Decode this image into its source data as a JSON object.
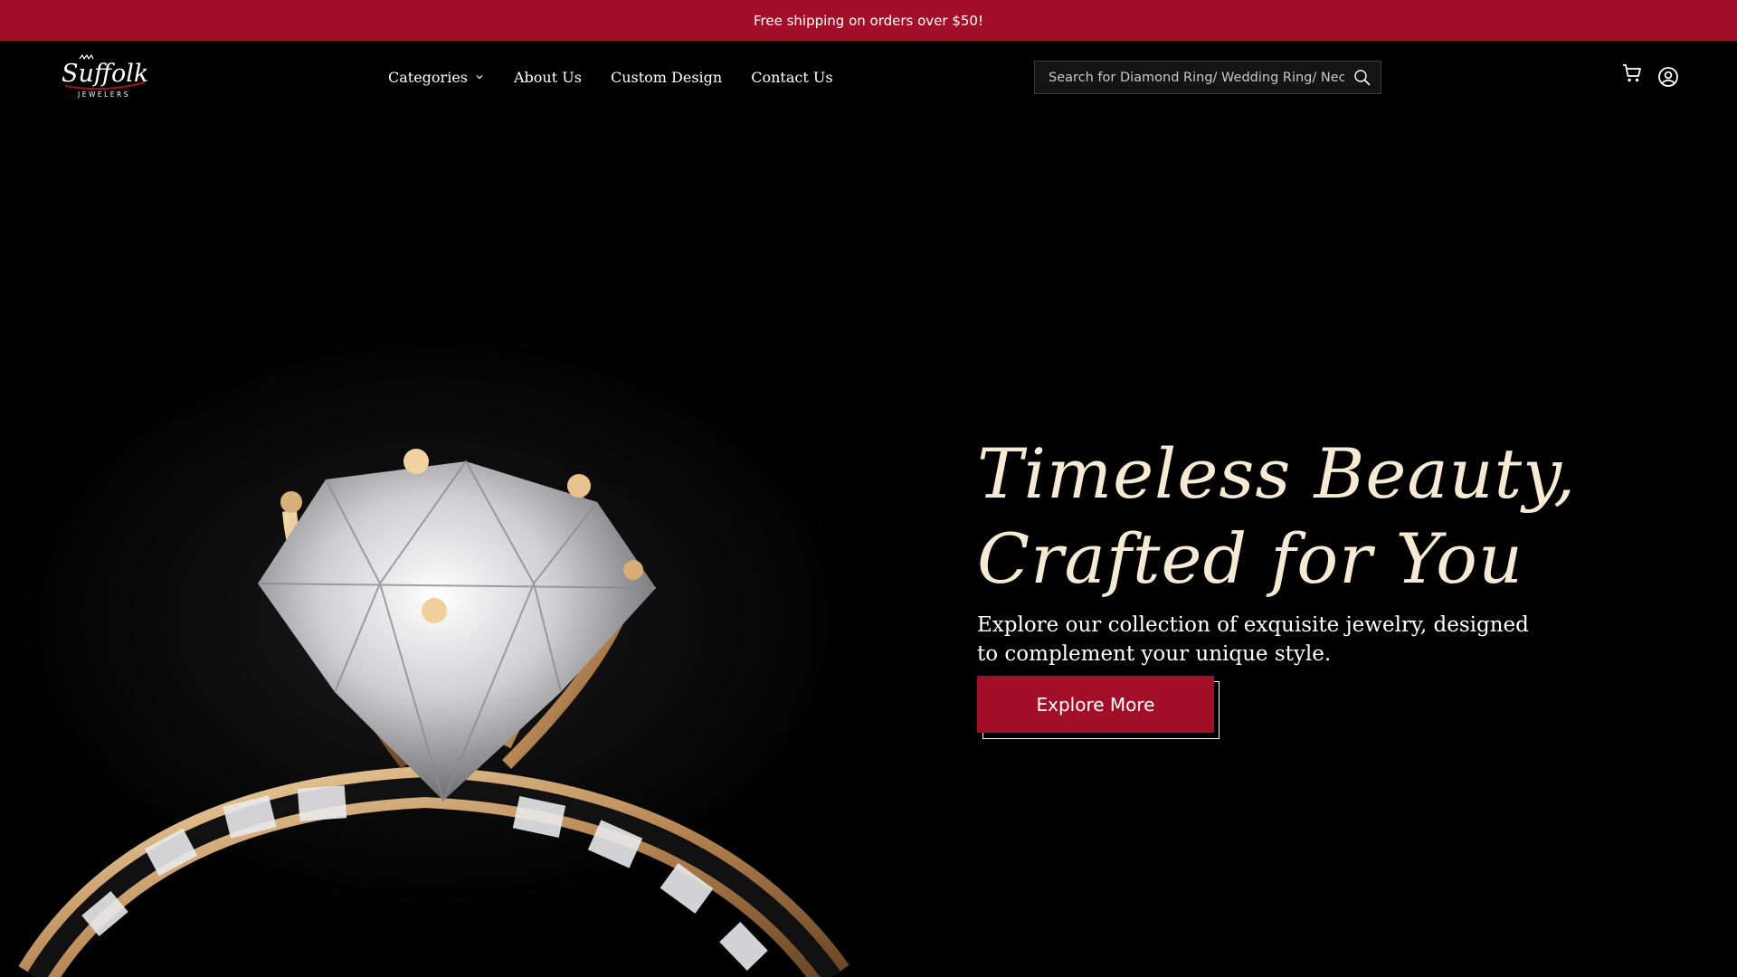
{
  "announcement": {
    "text": "Free shipping on orders over $50!"
  },
  "brand": {
    "logo_script": "Suffolk",
    "logo_caption": "JEWELERS"
  },
  "nav": {
    "items": [
      {
        "label": "Categories",
        "has_dropdown": true
      },
      {
        "label": "About Us"
      },
      {
        "label": "Custom Design"
      },
      {
        "label": "Contact Us"
      }
    ]
  },
  "search": {
    "placeholder": "Search for Diamond Ring/ Wedding Ring/ Necklace",
    "icon": "search-icon"
  },
  "header_icons": {
    "cart": "cart-icon",
    "account": "account-icon"
  },
  "hero": {
    "title_line1": "Timeless Beauty,",
    "title_line2": "Crafted for You",
    "subtitle": "Explore our collection of exquisite jewelry, designed to complement your unique style.",
    "cta_label": "Explore More"
  },
  "colors": {
    "brand_red": "#a20f28",
    "title_cream": "#f6ead4",
    "background": "#000000"
  }
}
